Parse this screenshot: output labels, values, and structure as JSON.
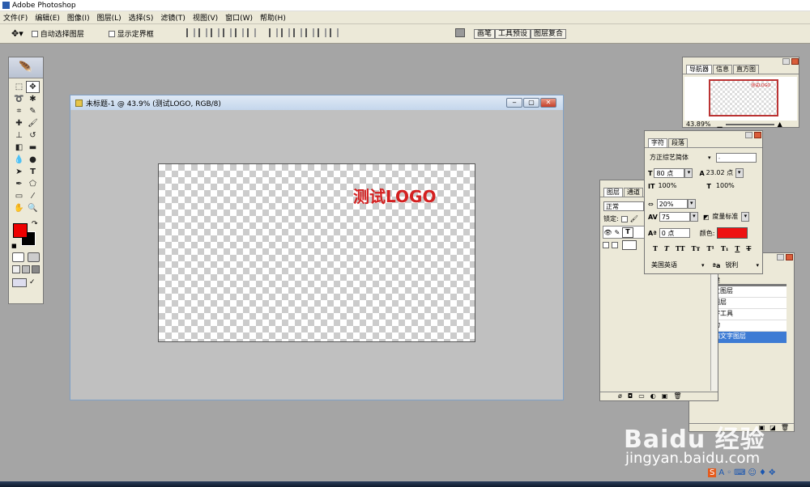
{
  "app_title": "Adobe Photoshop",
  "menu": [
    "文件(F)",
    "编辑(E)",
    "图像(I)",
    "图层(L)",
    "选择(S)",
    "滤镜(T)",
    "视图(V)",
    "窗口(W)",
    "帮助(H)"
  ],
  "options": {
    "auto_select_label": "自动选择图层",
    "show_bounds_label": "显示定界框"
  },
  "well_tabs": [
    "画笔",
    "工具预设",
    "图层复合"
  ],
  "document": {
    "title": "未标题-1 @ 43.9% (测试LOGO, RGB/8)",
    "layer_text": "测试LOGO"
  },
  "navigator": {
    "tabs": [
      "导航器",
      "信息",
      "直方图"
    ],
    "zoom": "43.89%",
    "thumb_text": "测试LOGO"
  },
  "character": {
    "tabs": [
      "字符",
      "段落"
    ],
    "font_family": "方正综艺简体",
    "font_style": "-",
    "font_size": "80 点",
    "leading": "23.02 点",
    "vertical_scale": "100%",
    "horizontal_scale": "100%",
    "tracking": "20%",
    "kerning_value": "75",
    "kerning_mode": "度量标准",
    "baseline_shift": "0 点",
    "color_label": "颜色:",
    "color": "#ee1111",
    "language": "美国英语",
    "aa_icon": "ªa",
    "antialias": "锐利"
  },
  "layers": {
    "tabs": [
      "图层",
      "通道"
    ],
    "blend_mode": "正常",
    "lock_label": "锁定:"
  },
  "history": {
    "items": [
      "建",
      "立图层",
      "图层",
      "字工具",
      "功",
      "编文字图层"
    ]
  },
  "colors": {
    "foreground": "#ee0000",
    "background": "#000000"
  },
  "watermark": {
    "brand": "Baidu 经验",
    "url": "jingyan.baidu.com"
  }
}
